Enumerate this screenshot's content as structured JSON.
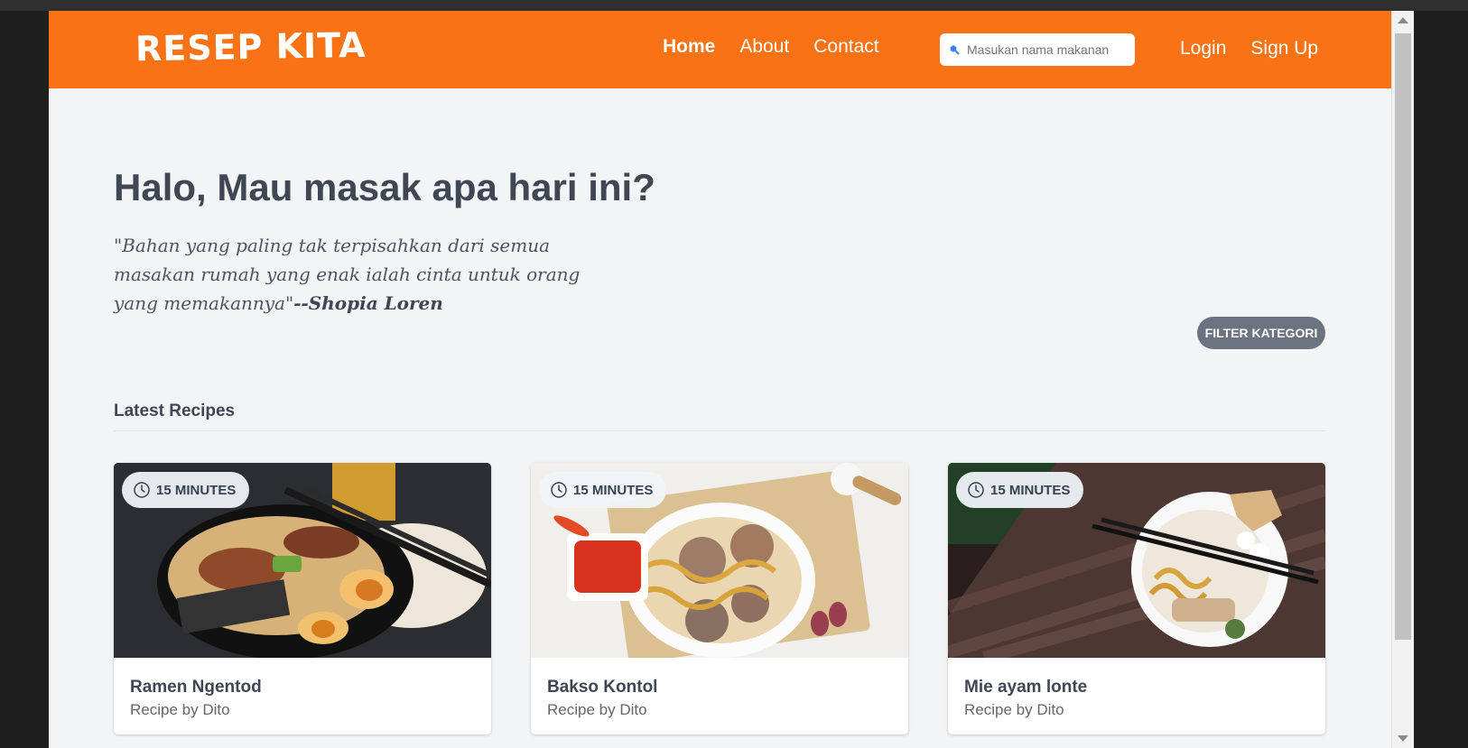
{
  "brand": "RESEP KITA",
  "nav": {
    "home": "Home",
    "about": "About",
    "contact": "Contact"
  },
  "search": {
    "placeholder": "Masukan nama makanan"
  },
  "auth": {
    "login": "Login",
    "signup": "Sign Up"
  },
  "hero": {
    "title": "Halo, Mau masak apa hari ini?",
    "quote": "\"Bahan yang paling tak terpisahkan dari semua masakan rumah yang enak ialah cinta untuk orang yang memakannya\"",
    "author": "--Shopia Loren"
  },
  "filter_button": "FILTER KATEGORI",
  "section": {
    "title": "Latest Recipes"
  },
  "cards": [
    {
      "time": "15 MINUTES",
      "title": "Ramen Ngentod",
      "meta": "Recipe by Dito"
    },
    {
      "time": "15 MINUTES",
      "title": "Bakso Kontol",
      "meta": "Recipe by Dito"
    },
    {
      "time": "15 MINUTES",
      "title": "Mie ayam lonte",
      "meta": "Recipe by Dito"
    }
  ],
  "colors": {
    "brand_orange": "#f97316",
    "page_bg": "#f3f4f6",
    "filter_gray": "#6b7280",
    "text_dark": "#3f4654"
  },
  "icons": {
    "search": "search-icon",
    "clock": "clock-icon"
  }
}
